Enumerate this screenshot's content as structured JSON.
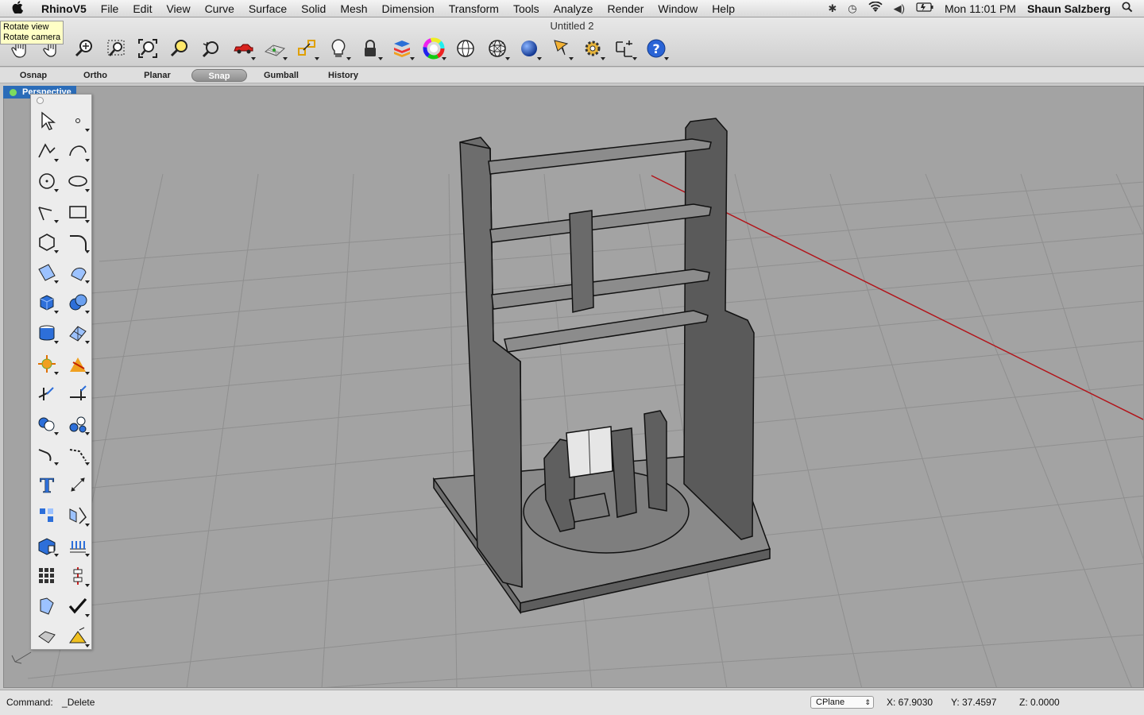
{
  "menubar": {
    "apple_icon": "apple-icon",
    "items": [
      {
        "label": "RhinoV5"
      },
      {
        "label": "File"
      },
      {
        "label": "Edit"
      },
      {
        "label": "View"
      },
      {
        "label": "Curve"
      },
      {
        "label": "Surface"
      },
      {
        "label": "Solid"
      },
      {
        "label": "Mesh"
      },
      {
        "label": "Dimension"
      },
      {
        "label": "Transform"
      },
      {
        "label": "Tools"
      },
      {
        "label": "Analyze"
      },
      {
        "label": "Render"
      },
      {
        "label": "Window"
      },
      {
        "label": "Help"
      }
    ],
    "clock": "Mon 11:01 PM",
    "user": "Shaun Salzberg"
  },
  "window": {
    "title": "Untitled 2"
  },
  "tooltip": {
    "line1": "Rotate view",
    "line2": "Rotate camera"
  },
  "toolbar": {
    "icons": [
      "pan-icon",
      "rotate-view-icon",
      "zoom-icon",
      "zoom-window-icon",
      "zoom-extents-icon",
      "zoom-selected-icon",
      "undo-view-icon",
      "car-icon",
      "grid-icon",
      "osnap-icon",
      "light-icon",
      "lock-icon",
      "layer-icon",
      "color-wheel-icon",
      "shaded-sphere-icon",
      "wireframe-sphere-icon",
      "render-sphere-icon",
      "cursor-icon",
      "gear-icon",
      "dimension-icon",
      "help-icon"
    ]
  },
  "modebar": {
    "items": [
      {
        "label": "Osnap",
        "active": false
      },
      {
        "label": "Ortho",
        "active": false
      },
      {
        "label": "Planar",
        "active": false
      },
      {
        "label": "Snap",
        "active": true
      },
      {
        "label": "Gumball",
        "active": false
      },
      {
        "label": "History",
        "active": false
      }
    ]
  },
  "viewport": {
    "name": "Perspective"
  },
  "sidebar": {
    "tools": [
      "select-icon",
      "point-icon",
      "polyline-icon",
      "curve-icon",
      "circle-icon",
      "ellipse-icon",
      "arc-icon",
      "rectangle-icon",
      "polygon-icon",
      "fillet-curve-icon",
      "surface-icon",
      "surface-edit-icon",
      "box-icon",
      "solid-union-icon",
      "cylinder-icon",
      "mesh-icon",
      "explode-icon",
      "split-icon",
      "trim-icon",
      "extend-icon",
      "boolean-icon",
      "group-icon",
      "fillet-icon",
      "chamfer-icon",
      "text-icon",
      "dimension-line-icon",
      "array-icon",
      "mirror-icon",
      "solid-box-icon",
      "contour-icon",
      "grid-array-icon",
      "align-icon",
      "transform-icon",
      "check-icon",
      "render-icon",
      "material-icon"
    ]
  },
  "status": {
    "command_label": "Command:",
    "command_value": "_Delete",
    "cplane": "CPlane",
    "x": "X: 67.9030",
    "y": "Y: 37.4597",
    "z": "Z: 0.0000"
  }
}
